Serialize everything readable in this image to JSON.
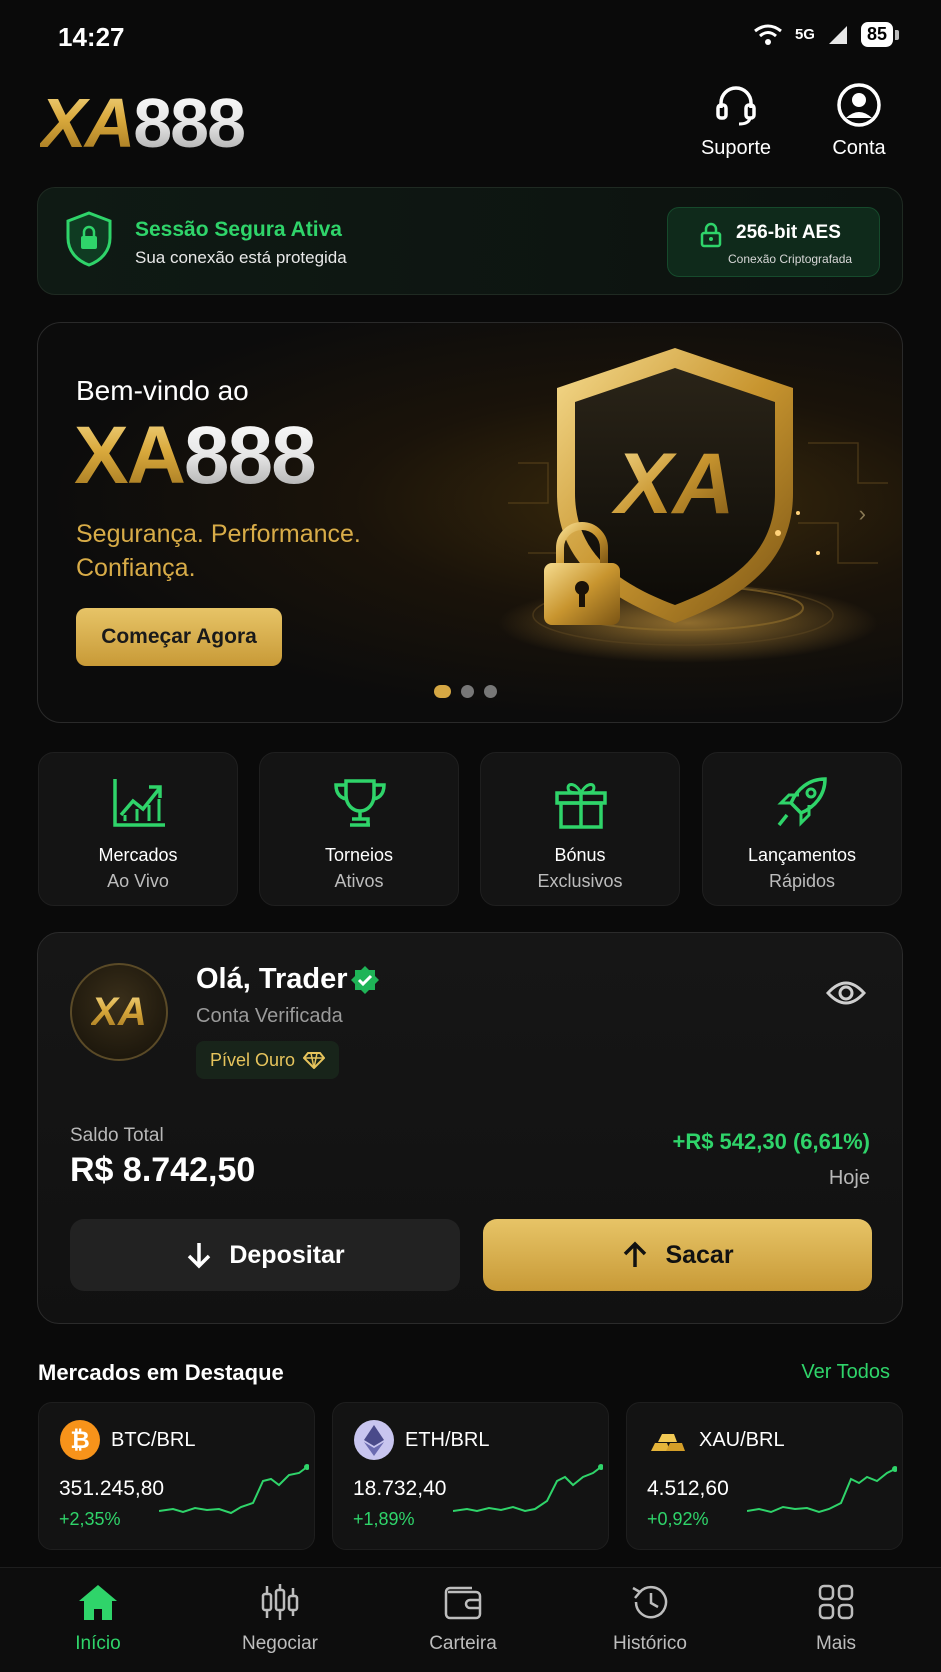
{
  "status_bar": {
    "time": "14:27",
    "network": "5G",
    "battery": "85"
  },
  "header": {
    "logo_gold": "XA",
    "logo_silver": "888",
    "support_label": "Suporte",
    "account_label": "Conta"
  },
  "secure_session": {
    "title": "Sessão Segura Ativa",
    "subtitle": "Sua conexão está protegida",
    "encryption_title": "256-bit AES",
    "encryption_subtitle": "Conexão Criptografada"
  },
  "banner": {
    "welcome": "Bem-vindo ao",
    "logo_gold": "XA",
    "logo_silver": "888",
    "tagline": "Segurança. Performance. Confiança.",
    "cta": "Começar Agora",
    "shield_text": "XA",
    "slide_count": 3,
    "active_slide": 1
  },
  "quick_actions": [
    {
      "icon": "chart-up-icon",
      "title": "Mercados",
      "subtitle": "Ao Vivo"
    },
    {
      "icon": "trophy-icon",
      "title": "Torneios",
      "subtitle": "Ativos"
    },
    {
      "icon": "gift-icon",
      "title": "Bónus",
      "subtitle": "Exclusivos"
    },
    {
      "icon": "rocket-icon",
      "title": "Lançamentos",
      "subtitle": "Rápidos"
    }
  ],
  "account": {
    "avatar_text": "XA",
    "greeting": "Olá, Trader",
    "status": "Conta Verificada",
    "level": "Pível Ouro",
    "balance_label": "Saldo Total",
    "balance": "R$ 8.742,50",
    "change": "+R$ 542,30 (6,61%)",
    "period": "Hoje",
    "deposit_label": "Depositar",
    "withdraw_label": "Sacar"
  },
  "markets": {
    "title": "Mercados em Destaque",
    "see_all": "Ver Todos",
    "items": [
      {
        "icon": "bitcoin-icon",
        "pair": "BTC/BRL",
        "price": "351.245,80",
        "change": "+2,35%"
      },
      {
        "icon": "ethereum-icon",
        "pair": "ETH/BRL",
        "price": "18.732,40",
        "change": "+1,89%"
      },
      {
        "icon": "gold-bars-icon",
        "pair": "XAU/BRL",
        "price": "4.512,60",
        "change": "+0,92%"
      }
    ]
  },
  "bottom_nav": [
    {
      "icon": "home-icon",
      "label": "Início",
      "active": true
    },
    {
      "icon": "candlestick-icon",
      "label": "Negociar",
      "active": false
    },
    {
      "icon": "wallet-icon",
      "label": "Carteira",
      "active": false
    },
    {
      "icon": "history-icon",
      "label": "Histórico",
      "active": false
    },
    {
      "icon": "grid-icon",
      "label": "Mais",
      "active": false
    }
  ],
  "colors": {
    "accent_green": "#2fd46a",
    "gold": "#d9a93c",
    "background": "#0a0a0a"
  }
}
